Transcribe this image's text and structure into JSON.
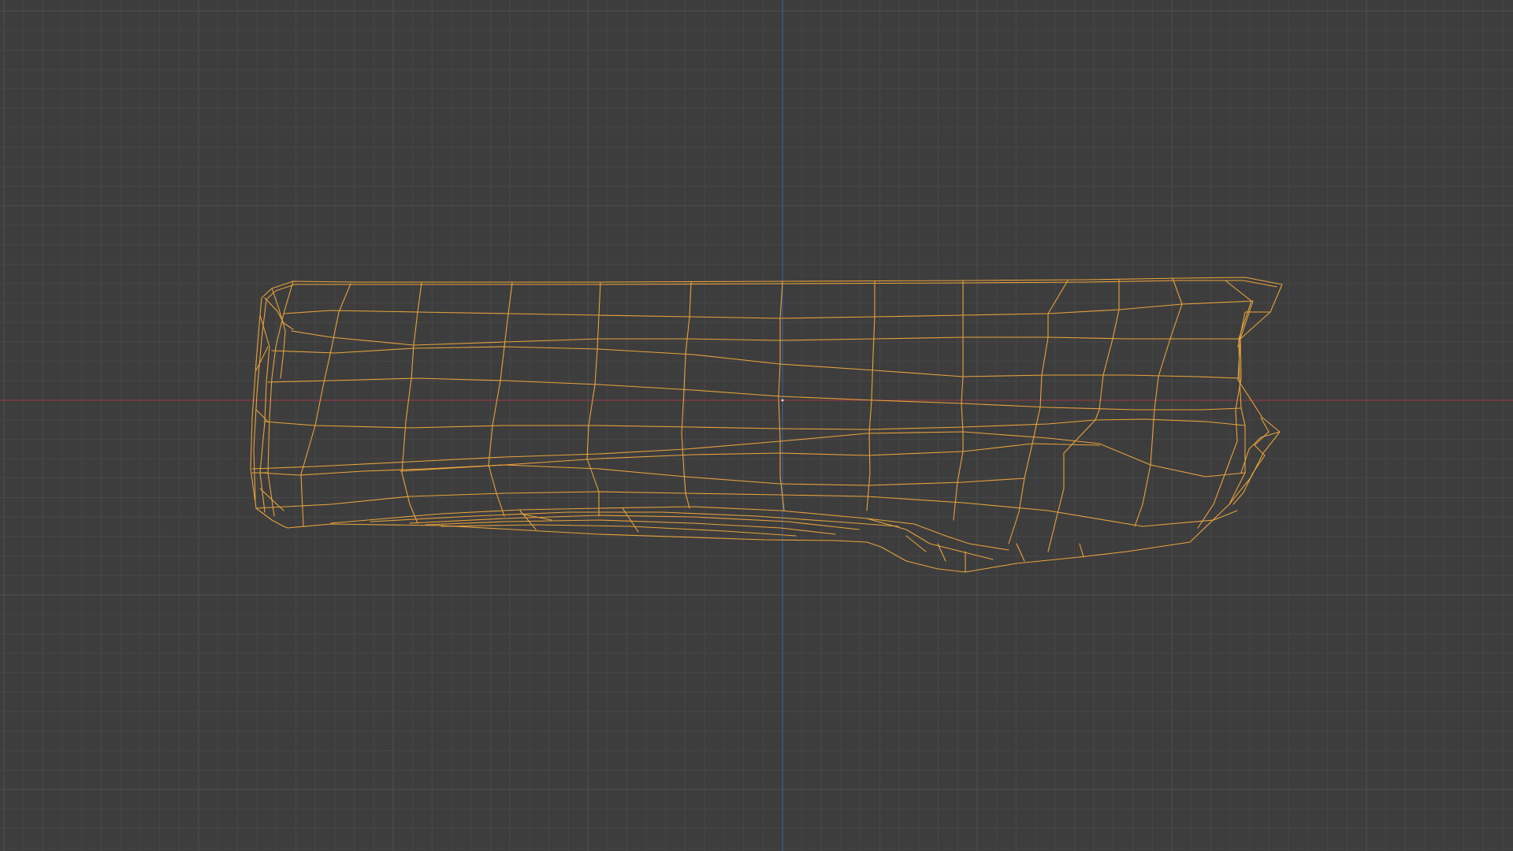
{
  "viewport": {
    "view": "front-orthographic",
    "shading": "wireframe",
    "grid_visible": true,
    "selected_object_type": "mesh"
  },
  "colors": {
    "background": "#3d3d3d",
    "grid_minor": "#474747",
    "grid_major": "#505050",
    "x_axis": "#8a3d44",
    "z_axis": "#3e5d8f",
    "wireframe": "#e8a33c",
    "origin_dot": "#e8e8e8"
  }
}
